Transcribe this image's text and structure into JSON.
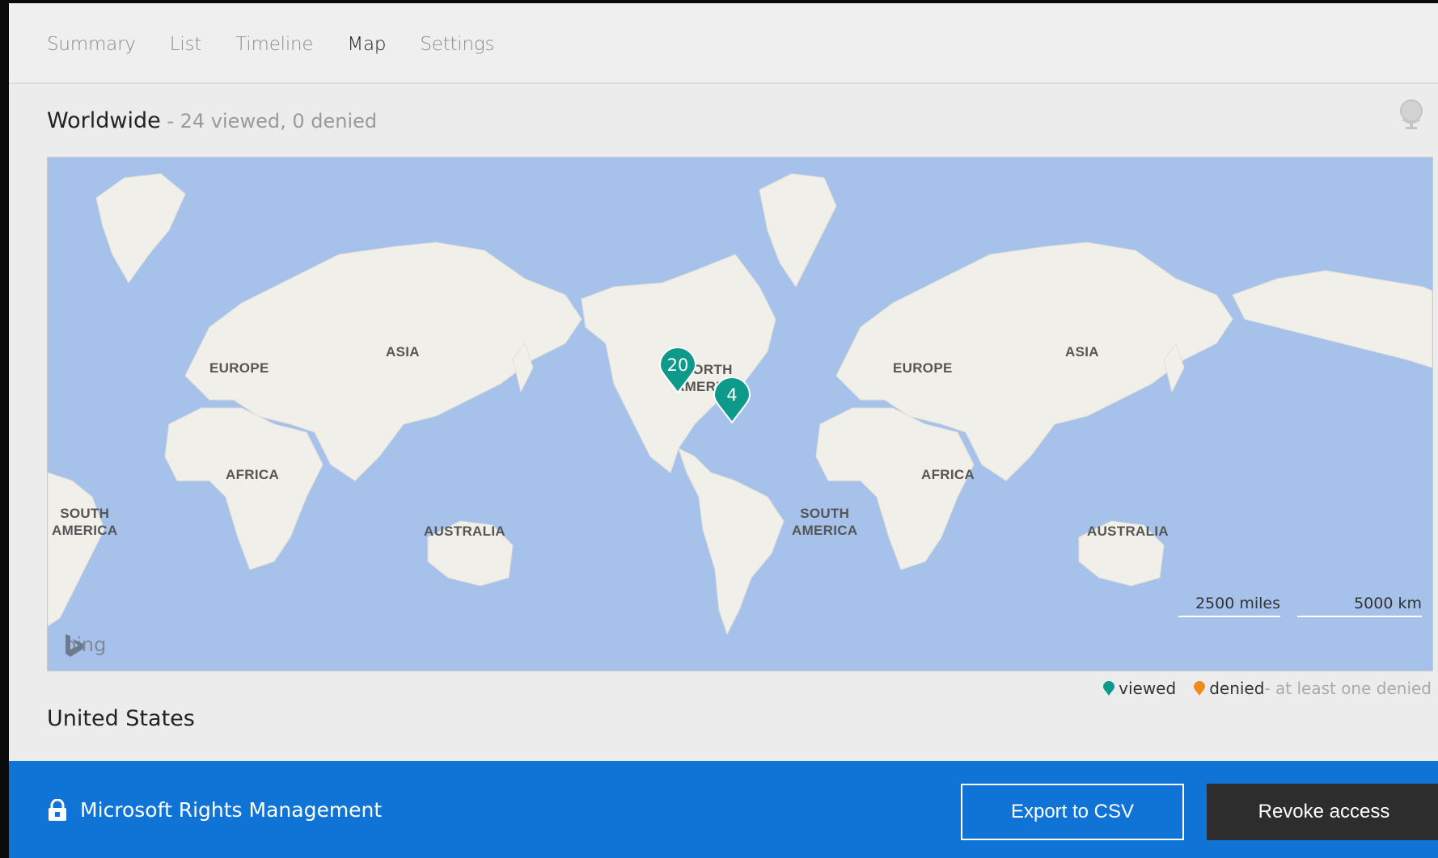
{
  "nav": {
    "tabs": [
      {
        "label": "Summary",
        "active": false
      },
      {
        "label": "List",
        "active": false
      },
      {
        "label": "Timeline",
        "active": false
      },
      {
        "label": "Map",
        "active": true
      },
      {
        "label": "Settings",
        "active": false
      }
    ]
  },
  "heading": {
    "title": "Worldwide",
    "subtitle": " - 24 viewed, 0 denied"
  },
  "map": {
    "provider": "bing",
    "labels": {
      "europe": "EUROPE",
      "asia": "ASIA",
      "africa": "AFRICA",
      "south_america": "SOUTH\nAMERICA",
      "australia": "AUSTRALIA",
      "north_america": "NORTH\nAMERICA"
    },
    "pins": [
      {
        "count": "20",
        "status": "viewed"
      },
      {
        "count": "4",
        "status": "viewed"
      }
    ],
    "scale": {
      "miles": "2500 miles",
      "km": "5000 km"
    }
  },
  "legend": {
    "viewed": "viewed",
    "denied": "denied",
    "note": " - at least one denied",
    "viewed_color": "#0e9a8a",
    "denied_color": "#f08a1c"
  },
  "region": "United States",
  "footer": {
    "brand": "Microsoft Rights Management",
    "export_label": "Export to CSV",
    "revoke_label": "Revoke access",
    "bg_color": "#0f74d6"
  },
  "icons": {
    "lock": "lock-icon",
    "globe": "globe-icon",
    "bing": "bing-logo-icon"
  }
}
